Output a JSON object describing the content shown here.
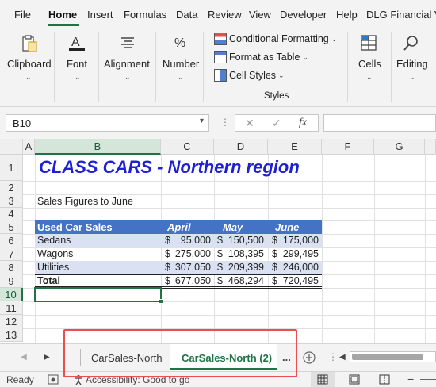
{
  "ribbon_tabs": [
    "File",
    "Home",
    "Insert",
    "Formulas",
    "Data",
    "Review",
    "View",
    "Developer",
    "Help",
    "DLG Financial V"
  ],
  "ribbon_active_tab": "Home",
  "ribbon": {
    "clipboard": "Clipboard",
    "font": "Font",
    "alignment": "Alignment",
    "number": "Number",
    "conditional_formatting": "Conditional Formatting",
    "format_as_table": "Format as Table",
    "cell_styles": "Cell Styles",
    "styles_group": "Styles",
    "cells": "Cells",
    "editing": "Editing"
  },
  "formula_bar": {
    "name_box": "B10",
    "fx": "fx",
    "cancel": "✕",
    "enter": "✓",
    "value": ""
  },
  "columns": [
    "A",
    "B",
    "C",
    "D",
    "E",
    "F",
    "G"
  ],
  "selected_column": "B",
  "rows": [
    "1",
    "2",
    "3",
    "4",
    "5",
    "6",
    "7",
    "8",
    "9",
    "10",
    "11",
    "12",
    "13"
  ],
  "selected_row": "10",
  "sheet": {
    "title": "CLASS CARS - Northern region",
    "subtitle": "Sales Figures to June",
    "table_header": [
      "Used Car Sales",
      "April",
      "May",
      "June"
    ],
    "table_rows": [
      {
        "label": "Sedans",
        "values": [
          {
            "cur": "$",
            "amt": "95,000"
          },
          {
            "cur": "$",
            "amt": "150,500"
          },
          {
            "cur": "$",
            "amt": "175,000"
          }
        ]
      },
      {
        "label": "Wagons",
        "values": [
          {
            "cur": "$",
            "amt": "275,000"
          },
          {
            "cur": "$",
            "amt": "108,395"
          },
          {
            "cur": "$",
            "amt": "299,495"
          }
        ]
      },
      {
        "label": "Utilities",
        "values": [
          {
            "cur": "$",
            "amt": "307,050"
          },
          {
            "cur": "$",
            "amt": "209,399"
          },
          {
            "cur": "$",
            "amt": "246,000"
          }
        ]
      }
    ],
    "total": {
      "label": "Total",
      "values": [
        {
          "cur": "$",
          "amt": "677,050"
        },
        {
          "cur": "$",
          "amt": "468,294"
        },
        {
          "cur": "$",
          "amt": "720,495"
        }
      ]
    }
  },
  "sheet_tabs": [
    "CarSales-North",
    "CarSales-North (2)"
  ],
  "active_sheet_tab": "CarSales-North (2)",
  "more_tabs": "...",
  "status": {
    "ready": "Ready",
    "accessibility": "Accessibility: Good to go"
  },
  "colors": {
    "accent": "#217346",
    "header_band": "#4472c4",
    "band": "#d9e1f2",
    "title": "#1f1fd6",
    "highlight_box": "#e8504f"
  }
}
